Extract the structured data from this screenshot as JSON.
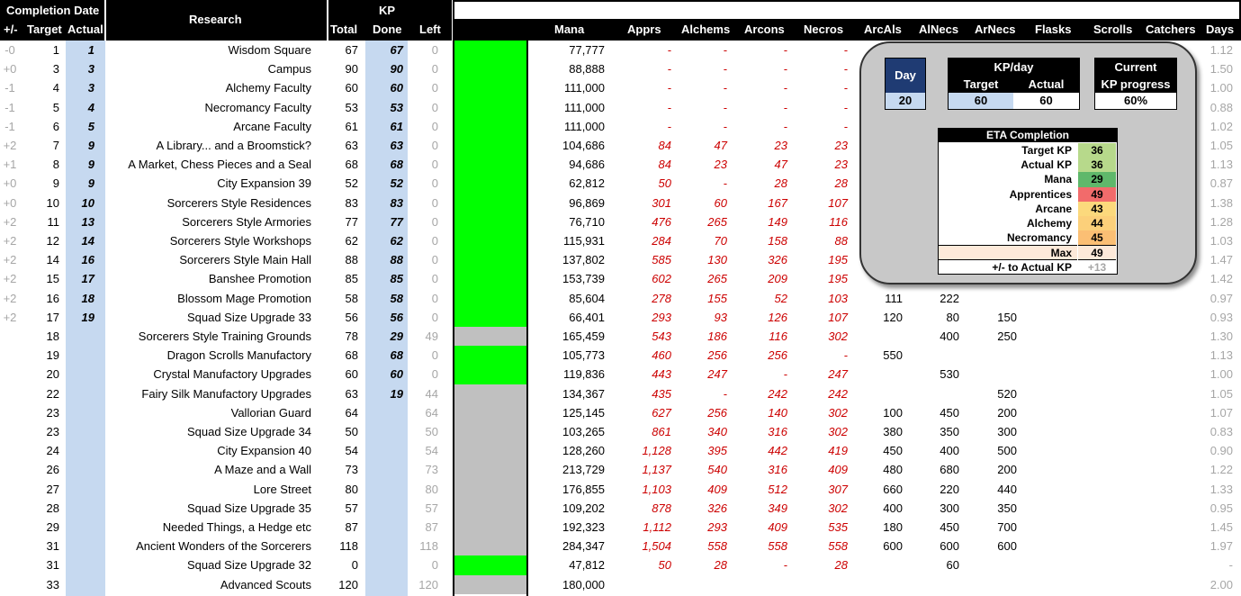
{
  "header": {
    "completion_date": "Completion Date",
    "research": "Research",
    "kp": "KP",
    "cols": [
      "+/-",
      "Target",
      "Actual",
      "Total",
      "Done",
      "Left",
      "Mana",
      "Apprs",
      "Alchems",
      "Arcons",
      "Necros",
      "ArcAls",
      "AlNecs",
      "ArNecs",
      "Flasks",
      "Scrolls",
      "Catchers",
      "Days"
    ]
  },
  "colors": {
    "done": "#00ff00",
    "remaining": "#c0c0c0",
    "highlight": "#c6d9f0",
    "negative_red": "#cc0000"
  },
  "rows": [
    {
      "pm": "-0",
      "target": "1",
      "actual": "1",
      "name": "Wisdom Square",
      "total": "67",
      "done": "67",
      "left": "0",
      "status": "done",
      "mana": "77,777",
      "apprs": "-",
      "alchems": "-",
      "arcons": "-",
      "necros": "-",
      "arcals": "",
      "alnecs": "",
      "arnecs": "",
      "days": "1.12"
    },
    {
      "pm": "+0",
      "target": "3",
      "actual": "3",
      "name": "Campus",
      "total": "90",
      "done": "90",
      "left": "0",
      "status": "done",
      "mana": "88,888",
      "apprs": "-",
      "alchems": "-",
      "arcons": "-",
      "necros": "-",
      "arcals": "",
      "alnecs": "",
      "arnecs": "",
      "days": "1.50"
    },
    {
      "pm": "-1",
      "target": "4",
      "actual": "3",
      "name": "Alchemy Faculty",
      "total": "60",
      "done": "60",
      "left": "0",
      "status": "done",
      "mana": "111,000",
      "apprs": "-",
      "alchems": "-",
      "arcons": "-",
      "necros": "-",
      "arcals": "",
      "alnecs": "",
      "arnecs": "",
      "days": "1.00"
    },
    {
      "pm": "-1",
      "target": "5",
      "actual": "4",
      "name": "Necromancy Faculty",
      "total": "53",
      "done": "53",
      "left": "0",
      "status": "done",
      "mana": "111,000",
      "apprs": "-",
      "alchems": "-",
      "arcons": "-",
      "necros": "-",
      "arcals": "",
      "alnecs": "",
      "arnecs": "",
      "days": "0.88"
    },
    {
      "pm": "-1",
      "target": "6",
      "actual": "5",
      "name": "Arcane Faculty",
      "total": "61",
      "done": "61",
      "left": "0",
      "status": "done",
      "mana": "111,000",
      "apprs": "-",
      "alchems": "-",
      "arcons": "-",
      "necros": "-",
      "arcals": "",
      "alnecs": "",
      "arnecs": "",
      "days": "1.02"
    },
    {
      "pm": "+2",
      "target": "7",
      "actual": "9",
      "name": "A Library... and a Broomstick?",
      "total": "63",
      "done": "63",
      "left": "0",
      "status": "done",
      "mana": "104,686",
      "apprs": "84",
      "alchems": "47",
      "arcons": "23",
      "necros": "23",
      "arcals": "",
      "alnecs": "",
      "arnecs": "",
      "days": "1.05"
    },
    {
      "pm": "+1",
      "target": "8",
      "actual": "9",
      "name": "A Market, Chess Pieces and a Seal",
      "total": "68",
      "done": "68",
      "left": "0",
      "status": "done",
      "mana": "94,686",
      "apprs": "84",
      "alchems": "23",
      "arcons": "47",
      "necros": "23",
      "arcals": "",
      "alnecs": "",
      "arnecs": "",
      "days": "1.13"
    },
    {
      "pm": "+0",
      "target": "9",
      "actual": "9",
      "name": "City Expansion 39",
      "total": "52",
      "done": "52",
      "left": "0",
      "status": "done",
      "mana": "62,812",
      "apprs": "50",
      "alchems": "-",
      "arcons": "28",
      "necros": "28",
      "arcals": "",
      "alnecs": "",
      "arnecs": "",
      "days": "0.87"
    },
    {
      "pm": "+0",
      "target": "10",
      "actual": "10",
      "name": "Sorcerers Style Residences",
      "total": "83",
      "done": "83",
      "left": "0",
      "status": "done",
      "mana": "96,869",
      "apprs": "301",
      "alchems": "60",
      "arcons": "167",
      "necros": "107",
      "arcals": "",
      "alnecs": "",
      "arnecs": "",
      "days": "1.38"
    },
    {
      "pm": "+2",
      "target": "11",
      "actual": "13",
      "name": "Sorcerers Style Armories",
      "total": "77",
      "done": "77",
      "left": "0",
      "status": "done",
      "mana": "76,710",
      "apprs": "476",
      "alchems": "265",
      "arcons": "149",
      "necros": "116",
      "arcals": "",
      "alnecs": "",
      "arnecs": "",
      "days": "1.28"
    },
    {
      "pm": "+2",
      "target": "12",
      "actual": "14",
      "name": "Sorcerers Style Workshops",
      "total": "62",
      "done": "62",
      "left": "0",
      "status": "done",
      "mana": "115,931",
      "apprs": "284",
      "alchems": "70",
      "arcons": "158",
      "necros": "88",
      "arcals": "",
      "alnecs": "",
      "arnecs": "",
      "days": "1.03"
    },
    {
      "pm": "+2",
      "target": "14",
      "actual": "16",
      "name": "Sorcerers Style Main Hall",
      "total": "88",
      "done": "88",
      "left": "0",
      "status": "done",
      "mana": "137,802",
      "apprs": "585",
      "alchems": "130",
      "arcons": "326",
      "necros": "195",
      "arcals": "",
      "alnecs": "",
      "arnecs": "",
      "days": "1.47"
    },
    {
      "pm": "+2",
      "target": "15",
      "actual": "17",
      "name": "Banshee Promotion",
      "total": "85",
      "done": "85",
      "left": "0",
      "status": "done",
      "mana": "153,739",
      "apprs": "602",
      "alchems": "265",
      "arcons": "209",
      "necros": "195",
      "arcals": "",
      "alnecs": "",
      "arnecs": "",
      "days": "1.42"
    },
    {
      "pm": "+2",
      "target": "16",
      "actual": "18",
      "name": "Blossom Mage Promotion",
      "total": "58",
      "done": "58",
      "left": "0",
      "status": "done",
      "mana": "85,604",
      "apprs": "278",
      "alchems": "155",
      "arcons": "52",
      "necros": "103",
      "arcals": "111",
      "alnecs": "222",
      "arnecs": "",
      "days": "0.97"
    },
    {
      "pm": "+2",
      "target": "17",
      "actual": "19",
      "name": "Squad Size Upgrade 33",
      "total": "56",
      "done": "56",
      "left": "0",
      "status": "done",
      "mana": "66,401",
      "apprs": "293",
      "alchems": "93",
      "arcons": "126",
      "necros": "107",
      "arcals": "120",
      "alnecs": "80",
      "arnecs": "150",
      "days": "0.93"
    },
    {
      "pm": "",
      "target": "18",
      "actual": "",
      "name": "Sorcerers Style Training Grounds",
      "total": "78",
      "done": "29",
      "left": "49",
      "status": "partial",
      "mana": "165,459",
      "apprs": "543",
      "alchems": "186",
      "arcons": "116",
      "necros": "302",
      "arcals": "",
      "alnecs": "400",
      "arnecs": "250",
      "days": "1.30"
    },
    {
      "pm": "",
      "target": "19",
      "actual": "",
      "name": "Dragon Scrolls Manufactory",
      "total": "68",
      "done": "68",
      "left": "0",
      "status": "done",
      "mana": "105,773",
      "apprs": "460",
      "alchems": "256",
      "arcons": "256",
      "necros": "-",
      "arcals": "550",
      "alnecs": "",
      "arnecs": "",
      "days": "1.13"
    },
    {
      "pm": "",
      "target": "20",
      "actual": "",
      "name": "Crystal Manufactory Upgrades",
      "total": "60",
      "done": "60",
      "left": "0",
      "status": "done",
      "mana": "119,836",
      "apprs": "443",
      "alchems": "247",
      "arcons": "-",
      "necros": "247",
      "arcals": "",
      "alnecs": "530",
      "arnecs": "",
      "days": "1.00"
    },
    {
      "pm": "",
      "target": "22",
      "actual": "",
      "name": "Fairy Silk Manufactory Upgrades",
      "total": "63",
      "done": "19",
      "left": "44",
      "status": "partial",
      "mana": "134,367",
      "apprs": "435",
      "alchems": "-",
      "arcons": "242",
      "necros": "242",
      "arcals": "",
      "alnecs": "",
      "arnecs": "520",
      "days": "1.05"
    },
    {
      "pm": "",
      "target": "23",
      "actual": "",
      "name": "Vallorian Guard",
      "total": "64",
      "done": "",
      "left": "64",
      "status": "todo",
      "mana": "125,145",
      "apprs": "627",
      "alchems": "256",
      "arcons": "140",
      "necros": "302",
      "arcals": "100",
      "alnecs": "450",
      "arnecs": "200",
      "days": "1.07"
    },
    {
      "pm": "",
      "target": "23",
      "actual": "",
      "name": "Squad Size Upgrade 34",
      "total": "50",
      "done": "",
      "left": "50",
      "status": "todo",
      "mana": "103,265",
      "apprs": "861",
      "alchems": "340",
      "arcons": "316",
      "necros": "302",
      "arcals": "380",
      "alnecs": "350",
      "arnecs": "300",
      "days": "0.83"
    },
    {
      "pm": "",
      "target": "24",
      "actual": "",
      "name": "City Expansion 40",
      "total": "54",
      "done": "",
      "left": "54",
      "status": "todo",
      "mana": "128,260",
      "apprs": "1,128",
      "alchems": "395",
      "arcons": "442",
      "necros": "419",
      "arcals": "450",
      "alnecs": "400",
      "arnecs": "500",
      "days": "0.90"
    },
    {
      "pm": "",
      "target": "26",
      "actual": "",
      "name": "A Maze and a Wall",
      "total": "73",
      "done": "",
      "left": "73",
      "status": "todo",
      "mana": "213,729",
      "apprs": "1,137",
      "alchems": "540",
      "arcons": "316",
      "necros": "409",
      "arcals": "480",
      "alnecs": "680",
      "arnecs": "200",
      "days": "1.22"
    },
    {
      "pm": "",
      "target": "27",
      "actual": "",
      "name": "Lore Street",
      "total": "80",
      "done": "",
      "left": "80",
      "status": "todo",
      "mana": "176,855",
      "apprs": "1,103",
      "alchems": "409",
      "arcons": "512",
      "necros": "307",
      "arcals": "660",
      "alnecs": "220",
      "arnecs": "440",
      "days": "1.33"
    },
    {
      "pm": "",
      "target": "28",
      "actual": "",
      "name": "Squad Size Upgrade 35",
      "total": "57",
      "done": "",
      "left": "57",
      "status": "todo",
      "mana": "109,202",
      "apprs": "878",
      "alchems": "326",
      "arcons": "349",
      "necros": "302",
      "arcals": "400",
      "alnecs": "300",
      "arnecs": "350",
      "days": "0.95"
    },
    {
      "pm": "",
      "target": "29",
      "actual": "",
      "name": "Needed Things, a Hedge etc",
      "total": "87",
      "done": "",
      "left": "87",
      "status": "todo",
      "mana": "192,323",
      "apprs": "1,112",
      "alchems": "293",
      "arcons": "409",
      "necros": "535",
      "arcals": "180",
      "alnecs": "450",
      "arnecs": "700",
      "days": "1.45"
    },
    {
      "pm": "",
      "target": "31",
      "actual": "",
      "name": "Ancient Wonders of the Sorcerers",
      "total": "118",
      "done": "",
      "left": "118",
      "status": "todo",
      "mana": "284,347",
      "apprs": "1,504",
      "alchems": "558",
      "arcons": "558",
      "necros": "558",
      "arcals": "600",
      "alnecs": "600",
      "arnecs": "600",
      "days": "1.97"
    },
    {
      "pm": "",
      "target": "31",
      "actual": "",
      "name": "Squad Size Upgrade 32",
      "total": "0",
      "done": "",
      "left": "0",
      "status": "done",
      "mana": "47,812",
      "apprs": "50",
      "alchems": "28",
      "arcons": "-",
      "necros": "28",
      "arcals": "",
      "alnecs": "60",
      "arnecs": "",
      "days": "-"
    },
    {
      "pm": "",
      "target": "33",
      "actual": "",
      "name": "Advanced Scouts",
      "total": "120",
      "done": "",
      "left": "120",
      "status": "todo",
      "mana": "180,000",
      "apprs": "",
      "alchems": "",
      "arcons": "",
      "necros": "",
      "arcals": "",
      "alnecs": "",
      "arnecs": "",
      "days": "2.00"
    }
  ],
  "panel": {
    "day_label": "Day",
    "day_value": "20",
    "kpday_label": "KP/day",
    "kpday_target_label": "Target",
    "kpday_actual_label": "Actual",
    "kpday_target": "60",
    "kpday_actual": "60",
    "current_label1": "Current",
    "current_label2": "KP progress",
    "current_value": "60%",
    "eta_title": "ETA Completion",
    "eta_rows": [
      {
        "label": "Target KP",
        "value": "36",
        "color": "#b7d98b"
      },
      {
        "label": "Actual KP",
        "value": "36",
        "color": "#b7d98b"
      },
      {
        "label": "Mana",
        "value": "29",
        "color": "#5fb86b"
      },
      {
        "label": "Apprentices",
        "value": "49",
        "color": "#f26b6b"
      },
      {
        "label": "Arcane",
        "value": "43",
        "color": "#fcd97c"
      },
      {
        "label": "Alchemy",
        "value": "44",
        "color": "#fcd07a"
      },
      {
        "label": "Necromancy",
        "value": "45",
        "color": "#fbbf74"
      }
    ],
    "eta_max_label": "Max",
    "eta_max_value": "49",
    "eta_diff_label": "+/- to Actual KP",
    "eta_diff_value": "+13"
  }
}
